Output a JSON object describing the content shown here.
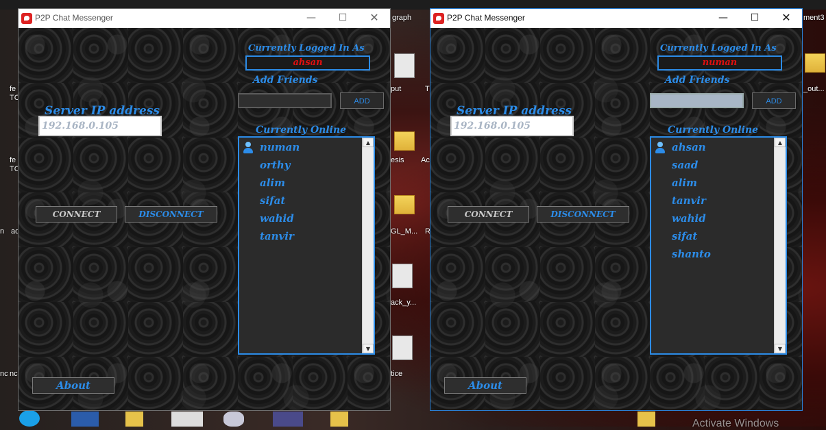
{
  "desktop": {
    "labels": [
      "graph",
      "put",
      "esis",
      "GL_M...",
      "ack_y...",
      "tice",
      "_out...",
      "ment3",
      "fe",
      "TC",
      "fe",
      "TC",
      "n",
      "ad",
      "Ac",
      "R",
      "nc",
      "nc",
      "T"
    ],
    "watermark": "Activate Windows"
  },
  "windows": [
    {
      "title": "P2P Chat Messenger",
      "controls": {
        "minimize": "—",
        "maximize": "☐",
        "close": "✕"
      },
      "logged_in_label": "Currently Logged In As",
      "logged_in_user": "ahsan",
      "add_friends_label": "Add Friends",
      "add_button": "ADD",
      "server_ip_label": "Server IP address",
      "server_ip_placeholder": "192.168.0.105",
      "currently_online_label": "Currently Online",
      "online_users": [
        "numan",
        "orthy",
        "alim",
        "sifat",
        "wahid",
        "tanvir"
      ],
      "connect_button": "CONNECT",
      "disconnect_button": "DISCONNECT",
      "about_button": "About",
      "friend_input_value": ""
    },
    {
      "title": "P2P Chat Messenger",
      "controls": {
        "minimize": "—",
        "maximize": "☐",
        "close": "✕"
      },
      "logged_in_label": "Currently Logged In As",
      "logged_in_user": "numan",
      "add_friends_label": "Add Friends",
      "add_button": "ADD",
      "server_ip_label": "Server IP address",
      "server_ip_placeholder": "192.168.0.105",
      "currently_online_label": "Currently Online",
      "online_users": [
        "ahsan",
        "saad",
        "alim",
        "tanvir",
        "wahid",
        "sifat",
        "shanto"
      ],
      "connect_button": "CONNECT",
      "disconnect_button": "DISCONNECT",
      "about_button": "About",
      "friend_input_value": ""
    }
  ],
  "colors": {
    "accent": "#2c8ce8",
    "username": "#e01010",
    "panel": "#141414"
  }
}
